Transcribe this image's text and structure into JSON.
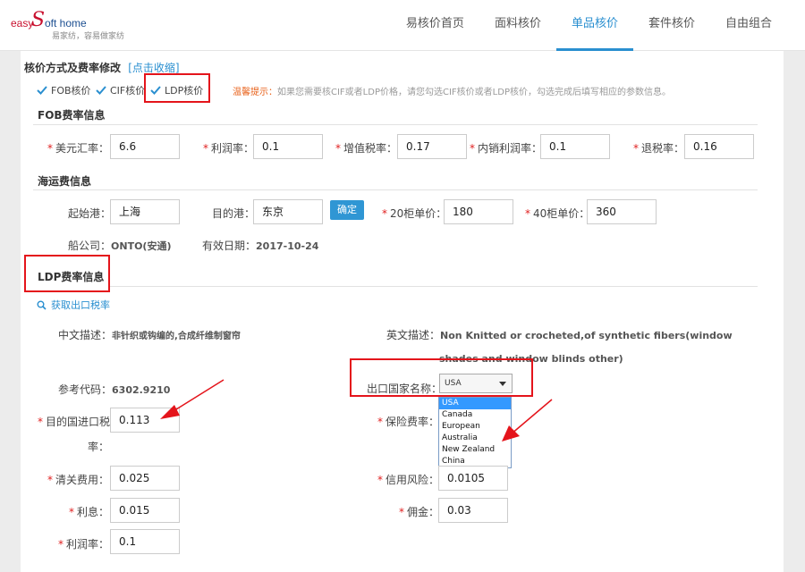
{
  "brand": {
    "logo_easy": "easy",
    "logo_s": "S",
    "logo_rest": "oft home",
    "tagline": "易家纺，容易做家纺"
  },
  "nav": [
    {
      "label": "易核价首页",
      "active": false
    },
    {
      "label": "面料核价",
      "active": false
    },
    {
      "label": "单品核价",
      "active": true
    },
    {
      "label": "套件核价",
      "active": false
    },
    {
      "label": "自由组合",
      "active": false
    }
  ],
  "pricing_method": {
    "title": "核价方式及费率修改",
    "collapse_link": "[点击收缩]",
    "options": [
      {
        "label": "FOB核价",
        "checked": true
      },
      {
        "label": "CIF核价",
        "checked": true
      },
      {
        "label": "LDP核价",
        "checked": true
      }
    ],
    "tip_label": "温馨提示：",
    "tip_text": "如果您需要核CIF或者LDP价格，请您勾选CIF核价或者LDP核价，勾选完成后填写相应的参数信息。"
  },
  "fob": {
    "title": "FOB费率信息",
    "fields": [
      {
        "label": "美元汇率：",
        "value": "6.6"
      },
      {
        "label": "利润率：",
        "value": "0.1"
      },
      {
        "label": "增值税率：",
        "value": "0.17"
      },
      {
        "label": "内销利润率：",
        "value": "0.1"
      },
      {
        "label": "退税率：",
        "value": "0.16"
      }
    ]
  },
  "shipping": {
    "title": "海运费信息",
    "origin_label": "起始港：",
    "origin_value": "上海",
    "dest_label": "目的港：",
    "dest_value": "东京",
    "confirm_button": "确定",
    "c20_label": "20柜单价：",
    "c20_value": "180",
    "c40_label": "40柜单价：",
    "c40_value": "360",
    "carrier_label": "船公司：",
    "carrier_value": "ONTO(安通)",
    "valid_label": "有效日期：",
    "valid_value": "2017-10-24"
  },
  "ldp": {
    "title": "LDP费率信息",
    "fetch_link": "获取出口税率",
    "cn_desc_label": "中文描述：",
    "cn_desc_value": "非针织或钩编的,合成纤维制窗帘",
    "en_desc_label": "英文描述：",
    "en_desc_line1": "Non Knitted or crocheted,of synthetic fibers(window",
    "en_desc_line2": "shades and window blinds other)",
    "ref_code_label": "参考代码：",
    "ref_code_value": "6302.9210",
    "country_label": "出口国家名称：",
    "country_selected": "USA",
    "country_options": [
      "USA",
      "Canada",
      "European",
      "Australia",
      "New Zealand",
      "China"
    ],
    "import_tax_label_1": "目的国进口税",
    "import_tax_label_2": "率：",
    "import_tax_value": "0.113",
    "insurance_label": "保险费率：",
    "customs_label": "清关费用：",
    "customs_value": "0.025",
    "credit_label": "信用风险：",
    "credit_value": "0.0105",
    "interest_label": "利息：",
    "interest_value": "0.015",
    "commission_label": "佣金：",
    "commission_value": "0.03",
    "profit_label": "利润率：",
    "profit_value": "0.1",
    "required_mark": "*"
  },
  "colors": {
    "accent": "#2a8fd0",
    "annotation_red": "#e4141b",
    "required": "#e02020"
  }
}
